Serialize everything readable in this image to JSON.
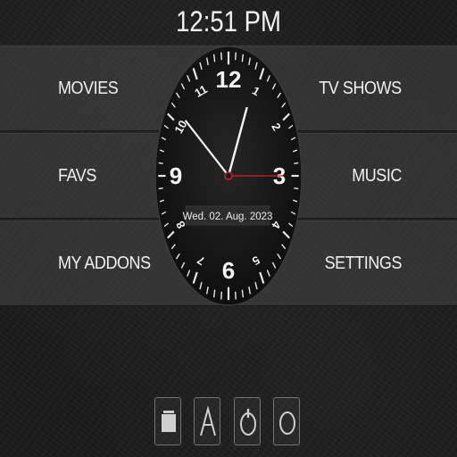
{
  "header": {
    "time": "12:51 PM"
  },
  "menu": {
    "movies": "MOVIES",
    "tv_shows": "TV SHOWS",
    "favs": "FAVS",
    "music": "MUSIC",
    "my_addons": "MY ADDONS",
    "settings": "SETTINGS"
  },
  "clock": {
    "date": "Wed. 02. Aug. 2023",
    "hour": 12,
    "minute": 51,
    "numerals": [
      "12",
      "3",
      "6",
      "9"
    ],
    "small_numerals": [
      "1",
      "2",
      "4",
      "5",
      "7",
      "8",
      "10",
      "11"
    ],
    "colors": {
      "face": "#0f0f0f",
      "hands": "#f4f4f4",
      "second_hand": "#d0202a"
    }
  },
  "bottom_bar": {
    "buttons": [
      {
        "icon": "favourites-box-icon"
      },
      {
        "icon": "addons-a-icon"
      },
      {
        "icon": "power-icon"
      },
      {
        "icon": "circle-icon"
      }
    ]
  }
}
